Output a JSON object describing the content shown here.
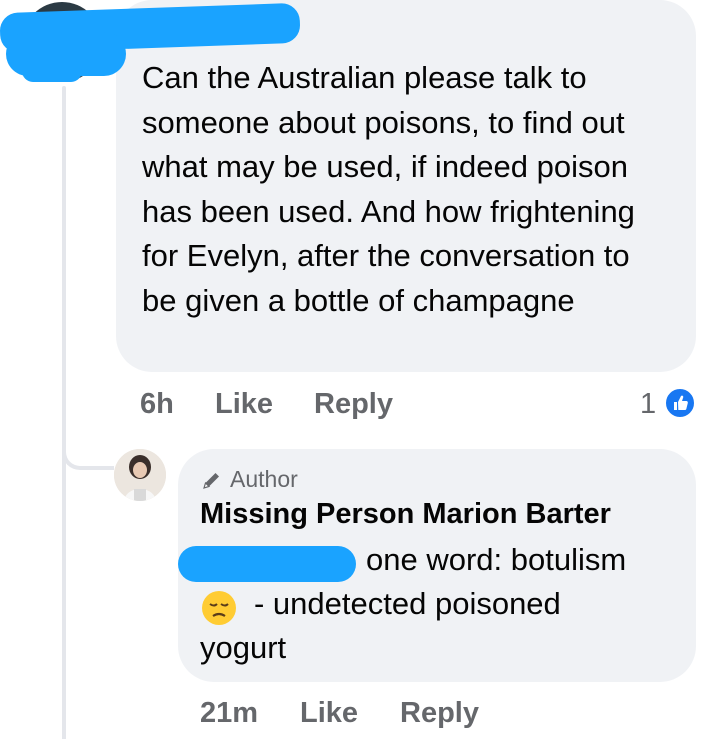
{
  "comment": {
    "text": "Can the Australian please talk to someone about poisons, to find out what may be used, if indeed poison has been used. And how frightening for Evelyn, after the conversation to be given a bottle of champagne",
    "time": "6h",
    "like_label": "Like",
    "reply_label": "Reply",
    "reaction_count": "1",
    "reaction_type": "like-icon"
  },
  "reply": {
    "badge": "Author",
    "author": "Missing Person Marion Barter",
    "line1": "one word: botulism",
    "emoji": "disappointed-face-emoji",
    "line2": "- undetected poisoned",
    "line3": "yogurt",
    "time": "21m",
    "like_label": "Like",
    "reply_label": "Reply"
  },
  "colors": {
    "bubble": "#f0f2f5",
    "meta_text": "#65676b",
    "body_text": "#050505",
    "like_blue": "#1877f2",
    "redaction": "#1aa3ff"
  }
}
